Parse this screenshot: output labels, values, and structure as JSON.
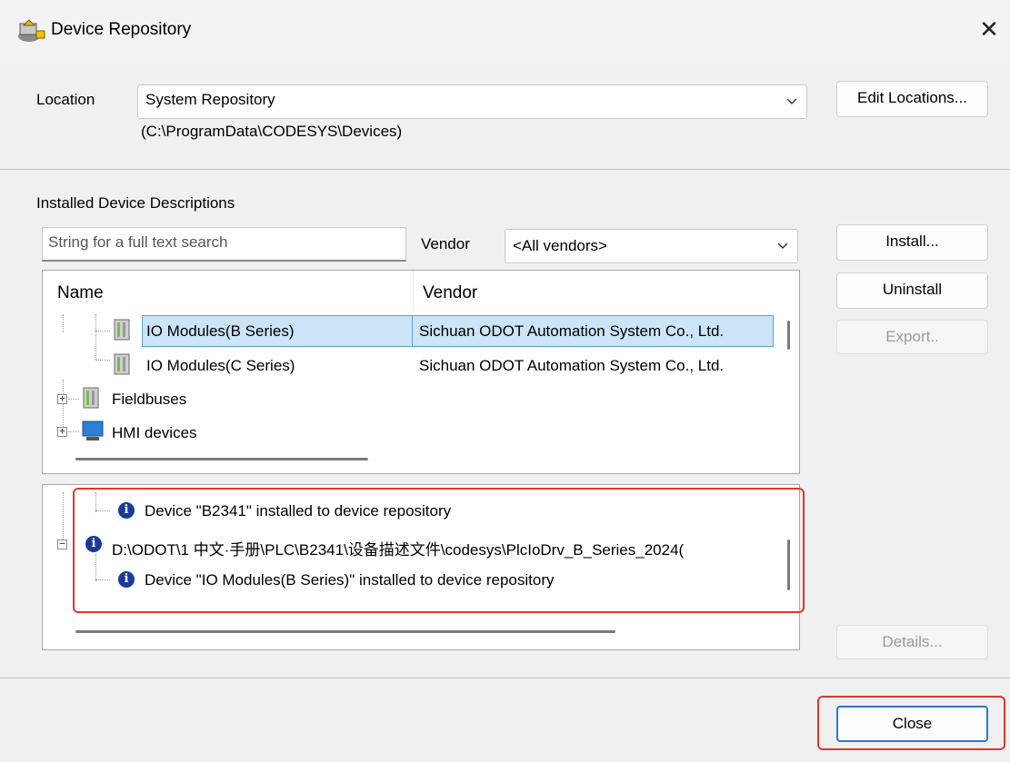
{
  "window": {
    "title": "Device Repository",
    "close_glyph": "✕"
  },
  "location": {
    "label": "Location",
    "selected": "System Repository",
    "path": "(C:\\ProgramData\\CODESYS\\Devices)",
    "edit_button": "Edit Locations..."
  },
  "installed": {
    "section_label": "Installed Device Descriptions",
    "search_placeholder": "String for a full text search",
    "vendor_label": "Vendor",
    "vendor_selected": "<All vendors>",
    "columns": {
      "name": "Name",
      "vendor": "Vendor"
    },
    "rows": [
      {
        "name": "IO Modules(B Series)",
        "vendor": "Sichuan ODOT Automation System Co., Ltd.",
        "selected": true
      },
      {
        "name": "IO Modules(C Series)",
        "vendor": "Sichuan ODOT Automation System Co., Ltd.",
        "selected": false
      },
      {
        "name": "Fieldbuses",
        "vendor": "",
        "expander": "+"
      },
      {
        "name": "HMI devices",
        "vendor": "",
        "expander": "+"
      }
    ]
  },
  "buttons": {
    "install": "Install...",
    "uninstall": "Uninstall",
    "export": "Export..",
    "details": "Details...",
    "close": "Close"
  },
  "log": {
    "entries": [
      {
        "text": "Device \"B2341\" installed to device repository"
      },
      {
        "text": "D:\\ODOT\\1 中文·手册\\PLC\\B2341\\设备描述文件\\codesys\\PlcIoDrv_B_Series_2024(",
        "expander": "−"
      },
      {
        "text": "Device \"IO Modules(B Series)\" installed to device repository"
      }
    ]
  },
  "colors": {
    "highlight_frame": "#e0362c",
    "selection": "#cce4f7",
    "info_icon": "#1a3a9a"
  },
  "icons": {
    "app": "device-repository-icon",
    "module": "io-module-icon",
    "hmi": "hmi-device-icon",
    "info": "info-icon"
  }
}
